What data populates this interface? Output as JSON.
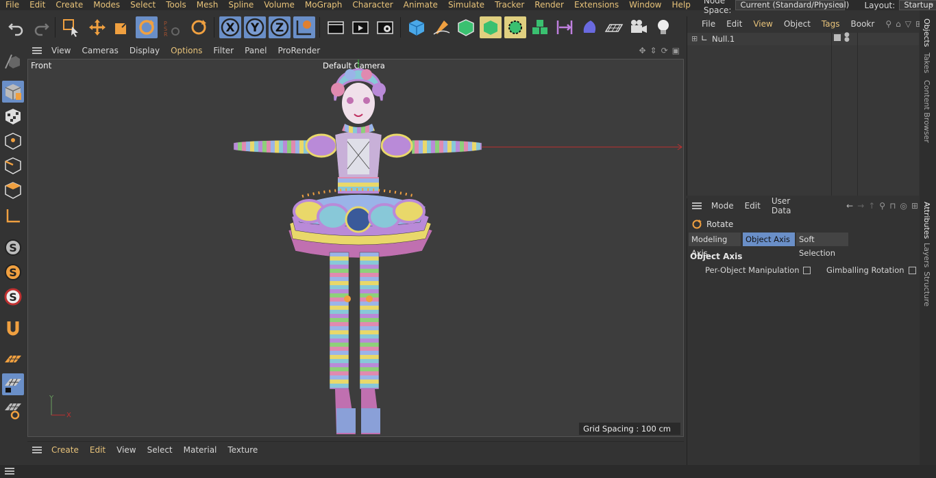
{
  "menubar": {
    "items": [
      "File",
      "Edit",
      "Create",
      "Modes",
      "Select",
      "Tools",
      "Mesh",
      "Spline",
      "Volume",
      "MoGraph",
      "Character",
      "Animate",
      "Simulate",
      "Tracker",
      "Render",
      "Extensions",
      "Window",
      "Help"
    ],
    "node_space_label": "Node Space:",
    "node_space_value": "Current (Standard/Physical)",
    "layout_label": "Layout:",
    "layout_value": "Startup"
  },
  "toolbar": {
    "icons": [
      "undo-icon",
      "redo-icon",
      "live-selection-icon",
      "move-icon",
      "scale-icon",
      "rotate-icon",
      "psr-icon",
      "recent-tool-icon",
      "x-axis-icon",
      "y-axis-icon",
      "z-axis-icon",
      "coordinate-system-icon",
      "render-view-icon",
      "render-picture-icon",
      "render-settings-icon",
      "cube-icon",
      "pen-icon",
      "subdivision-icon",
      "extrude-icon",
      "cloner-icon",
      "array-icon",
      "symmetry-icon",
      "deformer-icon",
      "floor-icon",
      "camera-icon",
      "light-icon"
    ],
    "axis_labels": {
      "x": "X",
      "y": "Y",
      "z": "Z"
    }
  },
  "viewport": {
    "menu": [
      "View",
      "Cameras",
      "Display",
      "Options",
      "Filter",
      "Panel",
      "ProRender"
    ],
    "active_menu": "Options",
    "view_name": "Front",
    "camera": "Default Camera",
    "grid_spacing": "Grid Spacing : 100 cm",
    "axis_y": "Y",
    "axis_x": "X"
  },
  "materials": {
    "menu": [
      "Create",
      "Edit",
      "View",
      "Select",
      "Material",
      "Texture"
    ]
  },
  "objects": {
    "menu": [
      "File",
      "Edit",
      "View",
      "Object",
      "Tags",
      "Bookr"
    ],
    "tree": [
      {
        "name": "Null.1"
      }
    ]
  },
  "attributes": {
    "menu": [
      "Mode",
      "Edit",
      "User Data"
    ],
    "tool_name": "Rotate",
    "tabs": [
      "Modeling Axis",
      "Object Axis",
      "Soft Selection"
    ],
    "active_tab": "Object Axis",
    "section_title": "Object Axis",
    "options": [
      {
        "label": "Per-Object Manipulation",
        "checked": false
      },
      {
        "label": "Gimballing Rotation",
        "checked": false
      }
    ]
  },
  "side_tabs_top": [
    "Objects",
    "Takes",
    "Content Browser"
  ],
  "side_tabs_bottom": [
    "Attributes",
    "Layers",
    "Structure"
  ],
  "colors": {
    "accent": "#e8c37a",
    "selected": "#6a8fc8"
  }
}
